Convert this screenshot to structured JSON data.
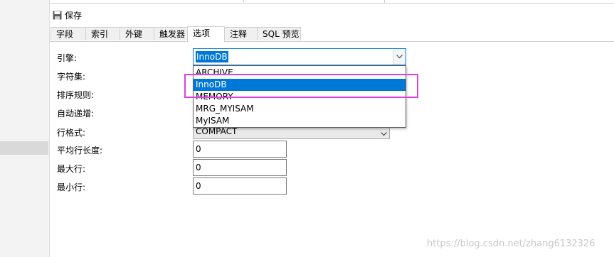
{
  "toolbar": {
    "save_label": "保存",
    "save_icon": "save-icon"
  },
  "tabs": [
    {
      "label": "字段"
    },
    {
      "label": "索引"
    },
    {
      "label": "外键"
    },
    {
      "label": "触发器"
    },
    {
      "label": "选项",
      "active": true
    },
    {
      "label": "注释"
    },
    {
      "label": "SQL 预览"
    }
  ],
  "form": {
    "engine": {
      "label": "引擎:",
      "value": "InnoDB"
    },
    "charset": {
      "label": "字符集:"
    },
    "collation": {
      "label": "排序规则:"
    },
    "auto_increment": {
      "label": "自动递增:"
    },
    "row_format": {
      "label": "行格式:",
      "value": "COMPACT"
    },
    "avg_row_length": {
      "label": "平均行长度:",
      "value": "0"
    },
    "max_rows": {
      "label": "最大行:",
      "value": "0"
    },
    "min_rows": {
      "label": "最小行:",
      "value": "0"
    }
  },
  "engine_dropdown": {
    "options": [
      "ARCHIVE",
      "InnoDB",
      "MEMORY",
      "MRG_MYISAM",
      "MyISAM"
    ],
    "selected": "InnoDB"
  },
  "colors": {
    "accent": "#0078d7",
    "annotation": "#e040e0"
  },
  "watermark": "https://blog.csdn.net/zhang6132326"
}
